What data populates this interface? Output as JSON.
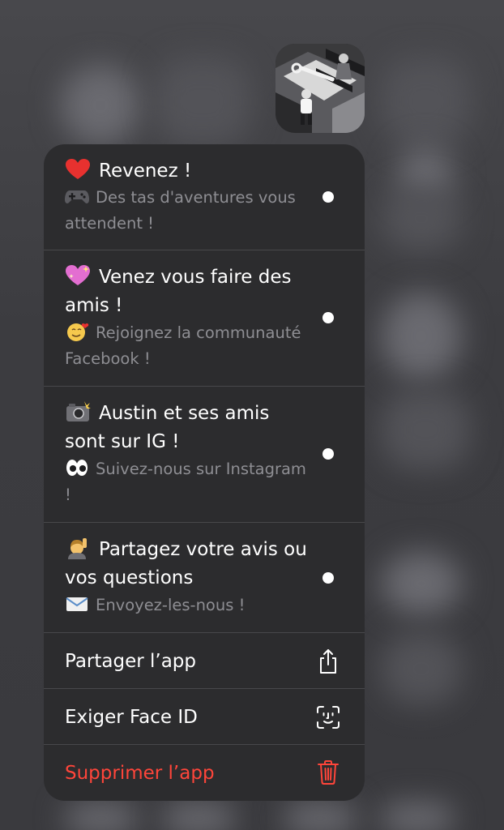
{
  "menu": {
    "items": [
      {
        "title": "Revenez !",
        "title_emoji": "red-heart-icon",
        "subtitle": "Des tas d'aventures vous attendent !",
        "subtitle_emoji": "game-controller-icon"
      },
      {
        "title": "Venez vous faire des amis !",
        "title_emoji": "sparkling-heart-icon",
        "subtitle": "Rejoignez la communauté Facebook !",
        "subtitle_emoji": "smiling-face-with-hearts-icon"
      },
      {
        "title": "Austin et ses amis sont sur IG !",
        "title_emoji": "camera-with-flash-icon",
        "subtitle": "Suivez-nous sur Instagram !",
        "subtitle_emoji": "eyes-icon"
      },
      {
        "title": "Partagez votre avis ou vos questions",
        "title_emoji": "person-raising-hand-icon",
        "subtitle": "Envoyez-les-nous !",
        "subtitle_emoji": "envelope-icon"
      }
    ],
    "actions": [
      {
        "label": "Partager l’app",
        "icon": "share-icon"
      },
      {
        "label": "Exiger Face ID",
        "icon": "face-id-icon"
      },
      {
        "label": "Supprimer l’app",
        "icon": "trash-icon",
        "destructive": true
      }
    ]
  },
  "colors": {
    "menu_background": "#2c2c2e",
    "primary_text": "#ffffff",
    "secondary_text": "#8e8e93",
    "destructive": "#ff453a"
  }
}
